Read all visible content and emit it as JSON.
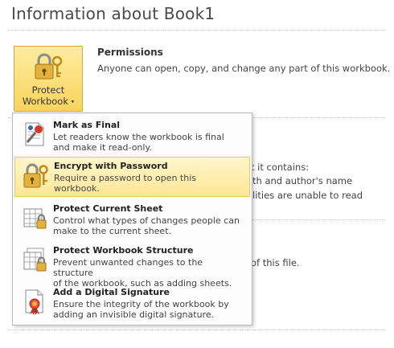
{
  "page": {
    "title": "Information about Book1"
  },
  "protect_button": {
    "line1": "Protect",
    "line2": "Workbook",
    "caret": "▾",
    "icon": "lock-keys-icon"
  },
  "permissions": {
    "heading": "Permissions",
    "description": "Anyone can open, copy, and change any part of this workbook."
  },
  "background_fragments": [
    "t it contains:",
    "th and author's name",
    "lities are unable to read",
    "of this file."
  ],
  "menu": {
    "items": [
      {
        "title": "Mark as Final",
        "desc_line1": "Let readers know the workbook is final",
        "desc_line2": "and make it read-only.",
        "icon": "mark-final-icon"
      },
      {
        "title": "Encrypt with Password",
        "desc_line1": "Require a password to open this",
        "desc_line2": "workbook.",
        "icon": "encrypt-lock-icon"
      },
      {
        "title": "Protect Current Sheet",
        "desc_line1": "Control what types of changes people can",
        "desc_line2": "make to the current sheet.",
        "icon": "protect-sheet-icon"
      },
      {
        "title": "Protect Workbook Structure",
        "desc_line1": "Prevent unwanted changes to the structure",
        "desc_line2": "of the workbook, such as adding sheets.",
        "icon": "protect-structure-icon"
      },
      {
        "title": "Add a Digital Signature",
        "desc_line1": "Ensure the integrity of the workbook by",
        "desc_line2": "adding an invisible digital signature.",
        "icon": "digital-signature-icon"
      }
    ]
  },
  "colors": {
    "highlight": "#fde795",
    "button_gold": "#f9d45c",
    "title_gray": "#4a4a4a"
  }
}
